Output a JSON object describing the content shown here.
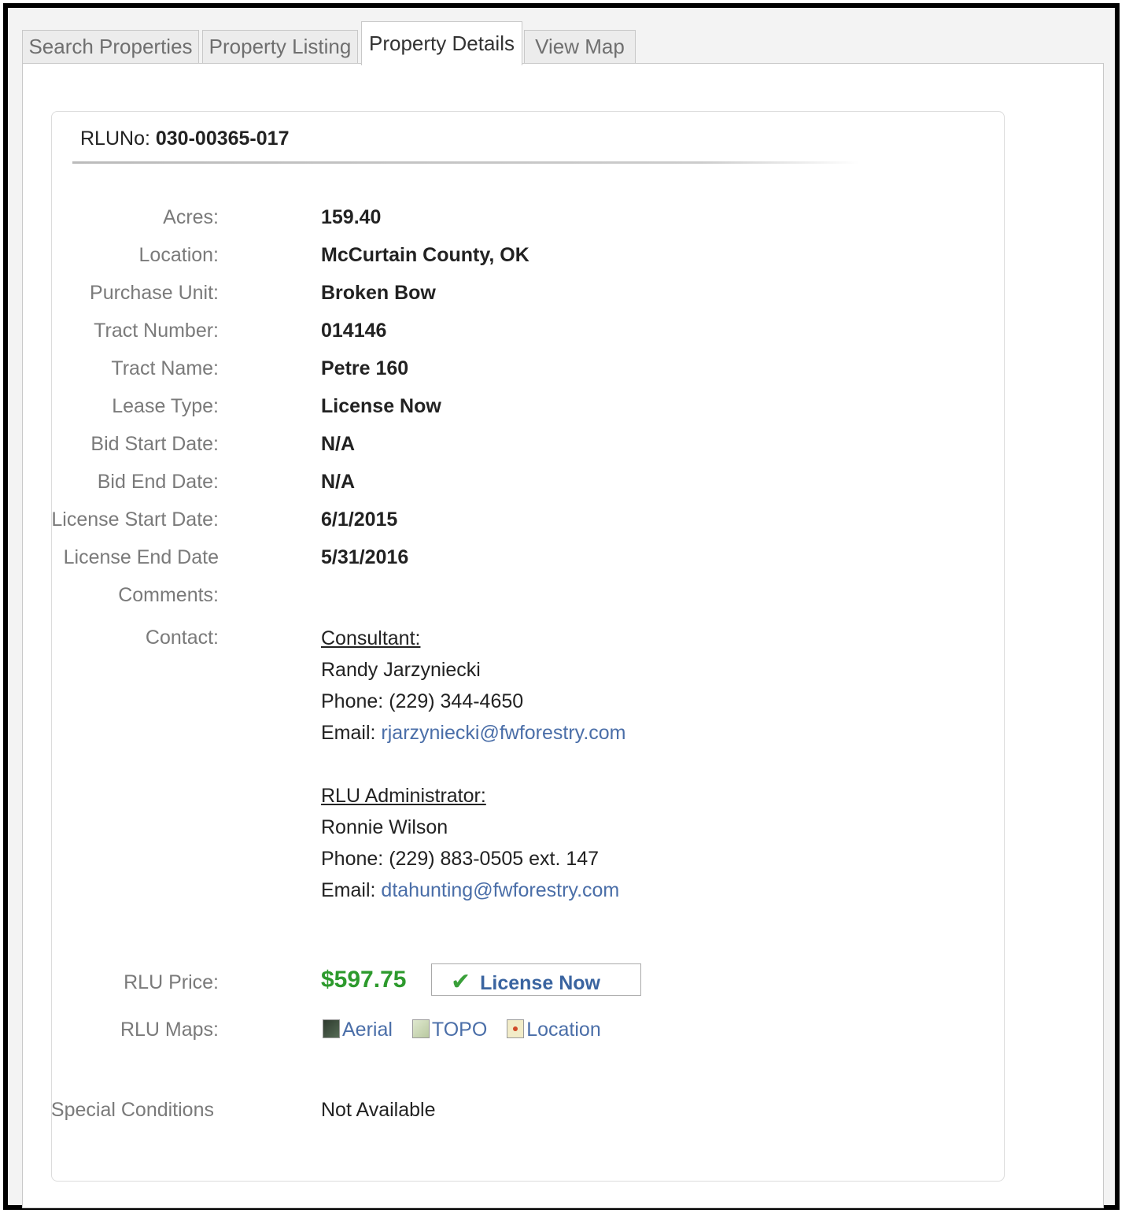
{
  "tabs": [
    {
      "label": "Search Properties",
      "active": false
    },
    {
      "label": "Property Listing",
      "active": false
    },
    {
      "label": "Property Details",
      "active": true
    },
    {
      "label": "View Map",
      "active": false
    }
  ],
  "rlu": {
    "label": "RLUNo:",
    "value": "030-00365-017"
  },
  "details": [
    {
      "label": "Acres:",
      "value": "159.40"
    },
    {
      "label": "Location:",
      "value": "McCurtain County, OK"
    },
    {
      "label": "Purchase Unit:",
      "value": "Broken Bow"
    },
    {
      "label": "Tract Number:",
      "value": "014146"
    },
    {
      "label": "Tract Name:",
      "value": "Petre 160"
    },
    {
      "label": "Lease Type:",
      "value": "License Now"
    },
    {
      "label": "Bid Start Date:",
      "value": "N/A"
    },
    {
      "label": "Bid End Date:",
      "value": "N/A"
    },
    {
      "label": "License Start Date:",
      "value": "6/1/2015"
    },
    {
      "label": "License End Date",
      "value": "5/31/2016"
    },
    {
      "label": "Comments:",
      "value": ""
    }
  ],
  "contact": {
    "label": "Contact:",
    "consultant": {
      "heading": "Consultant:",
      "name": "Randy Jarzyniecki",
      "phone_label": "Phone:",
      "phone": "(229) 344-4650",
      "email_label": "Email:",
      "email": "rjarzyniecki@fwforestry.com"
    },
    "admin": {
      "heading": "RLU Administrator:",
      "name": "Ronnie Wilson",
      "phone_label": "Phone:",
      "phone": "(229) 883-0505 ext. 147",
      "email_label": "Email:",
      "email": "dtahunting@fwforestry.com"
    }
  },
  "price": {
    "label": "RLU Price:",
    "value": "$597.75",
    "button": "License Now",
    "check_icon": "checkmark-icon"
  },
  "maps": {
    "label": "RLU Maps:",
    "items": [
      {
        "label": "Aerial",
        "icon": "aerial-map-icon"
      },
      {
        "label": "TOPO",
        "icon": "topo-map-icon"
      },
      {
        "label": "Location",
        "icon": "location-map-icon"
      }
    ]
  },
  "special": {
    "label": "Special Conditions",
    "value": "Not Available"
  },
  "colors": {
    "price": "#2d9a2d",
    "link": "#4a6ea8",
    "button_text": "#3a64a0",
    "check": "#3aa03a"
  }
}
